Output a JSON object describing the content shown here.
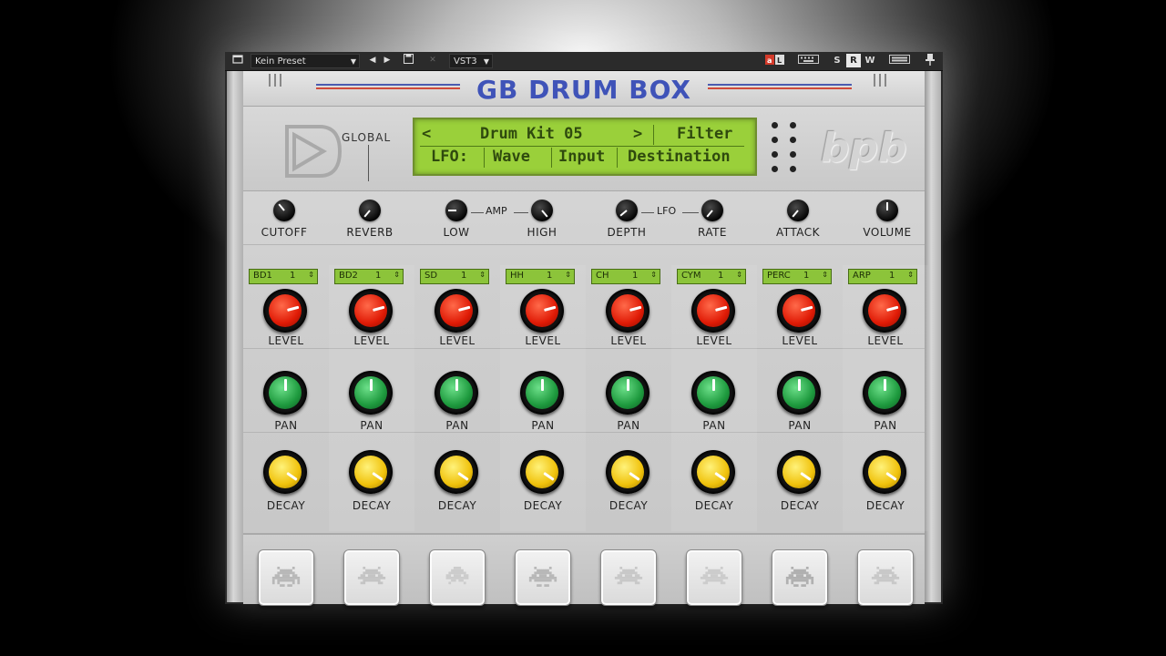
{
  "host": {
    "preset": "Kein Preset",
    "format": "VST3",
    "toggles": [
      "S",
      "R",
      "W"
    ]
  },
  "title": "GB DRUM BOX",
  "global_label": "GLOBAL",
  "lcd": {
    "kit": "Drum Kit 05",
    "prev": "<",
    "next": ">",
    "filter": "Filter",
    "lfo": "LFO:",
    "wave": "Wave",
    "input": "Input",
    "destination": "Destination"
  },
  "brand": "bpb",
  "global_knobs": {
    "cutoff": "CUTOFF",
    "reverb": "REVERB",
    "low": "LOW",
    "high": "HIGH",
    "depth": "DEPTH",
    "rate": "RATE",
    "attack": "ATTACK",
    "volume": "VOLUME",
    "amp_group": "AMP",
    "lfo_group": "LFO"
  },
  "channels": [
    {
      "name": "BD1",
      "value": "1"
    },
    {
      "name": "BD2",
      "value": "1"
    },
    {
      "name": "SD",
      "value": "1"
    },
    {
      "name": "HH",
      "value": "1"
    },
    {
      "name": "CH",
      "value": "1"
    },
    {
      "name": "CYM",
      "value": "1"
    },
    {
      "name": "PERC",
      "value": "1"
    },
    {
      "name": "ARP",
      "value": "1"
    }
  ],
  "labels": {
    "level": "LEVEL",
    "pan": "PAN",
    "decay": "DECAY"
  },
  "colors": {
    "title": "#3f53b8",
    "lcd": "#9ad03a",
    "level_knob": "#e01b06",
    "pan_knob": "#1e9a3e",
    "decay_knob": "#f0c20c"
  }
}
